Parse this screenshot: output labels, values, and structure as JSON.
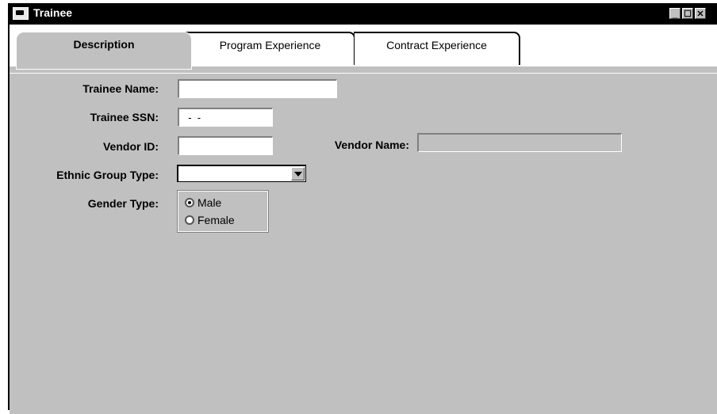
{
  "window": {
    "title": "Trainee",
    "controls": {
      "minimize": "_",
      "maximize": "☐",
      "close": "✕"
    }
  },
  "tabs": [
    {
      "label": "Description",
      "active": true
    },
    {
      "label": "Program Experience",
      "active": false
    },
    {
      "label": "Contract Experience",
      "active": false
    }
  ],
  "form": {
    "trainee_name": {
      "label": "Trainee Name:",
      "value": ""
    },
    "trainee_ssn": {
      "label": "Trainee SSN:",
      "value": "  -  -"
    },
    "vendor_id": {
      "label": "Vendor ID:",
      "value": ""
    },
    "vendor_name": {
      "label": "Vendor Name:",
      "value": ""
    },
    "ethnic_group_type": {
      "label": "Ethnic Group Type:",
      "value": ""
    },
    "gender_type": {
      "label": "Gender Type:",
      "options": [
        {
          "label": "Male",
          "checked": true
        },
        {
          "label": "Female",
          "checked": false
        }
      ]
    }
  }
}
